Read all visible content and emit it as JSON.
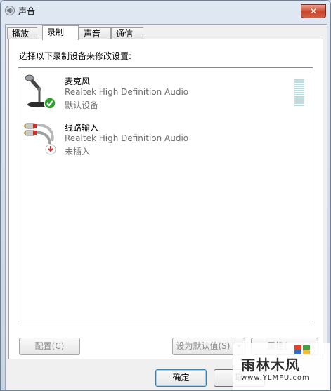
{
  "window": {
    "title": "声音",
    "close_label": "✕"
  },
  "tabs": [
    {
      "label": "播放",
      "active": false
    },
    {
      "label": "录制",
      "active": true
    },
    {
      "label": "声音",
      "active": false
    },
    {
      "label": "通信",
      "active": false
    }
  ],
  "panel": {
    "instruction": "选择以下录制设备来修改设置:"
  },
  "devices": [
    {
      "name": "麦克风",
      "description": "Realtek High Definition Audio",
      "status": "默认设备",
      "icon": "microphone-icon",
      "badge": "default-check-icon",
      "badge_color": "#2f9e2f"
    },
    {
      "name": "线路输入",
      "description": "Realtek High Definition Audio",
      "status": "未插入",
      "icon": "line-in-jack-icon",
      "badge": "unplugged-arrow-icon",
      "badge_color": "#d52b2b"
    }
  ],
  "buttons": {
    "configure": "配置(C)",
    "set_default": "设为默认值(S)",
    "properties": "属性(",
    "ok": "确定",
    "cancel": "取"
  },
  "watermark": {
    "brand": "雨林木风",
    "url": "www.YLMFU.com"
  }
}
